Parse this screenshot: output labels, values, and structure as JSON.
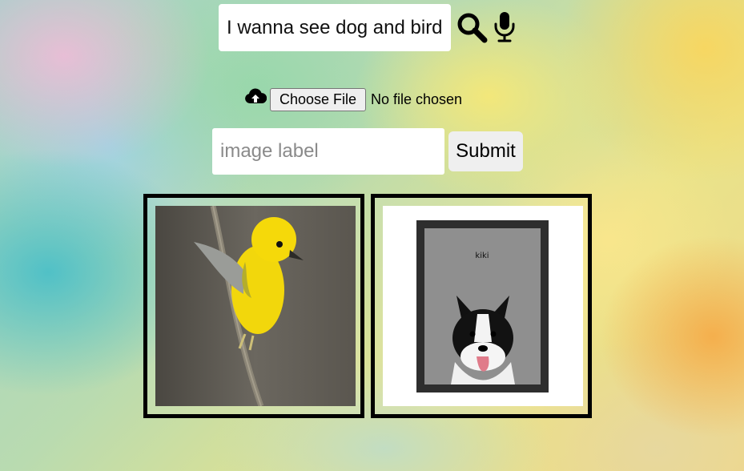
{
  "search": {
    "query": "I wanna see dog and bird",
    "search_icon": "magnifying-glass",
    "mic_icon": "microphone"
  },
  "upload": {
    "icon": "cloud-upload",
    "choose_label": "Choose File",
    "status": "No file chosen"
  },
  "label_form": {
    "placeholder": "image label",
    "value": "",
    "submit_label": "Submit"
  },
  "gallery": [
    {
      "image": "yellow bird perched on branch",
      "caption": ""
    },
    {
      "image": "framed dog portrait",
      "caption": "kiki"
    }
  ]
}
